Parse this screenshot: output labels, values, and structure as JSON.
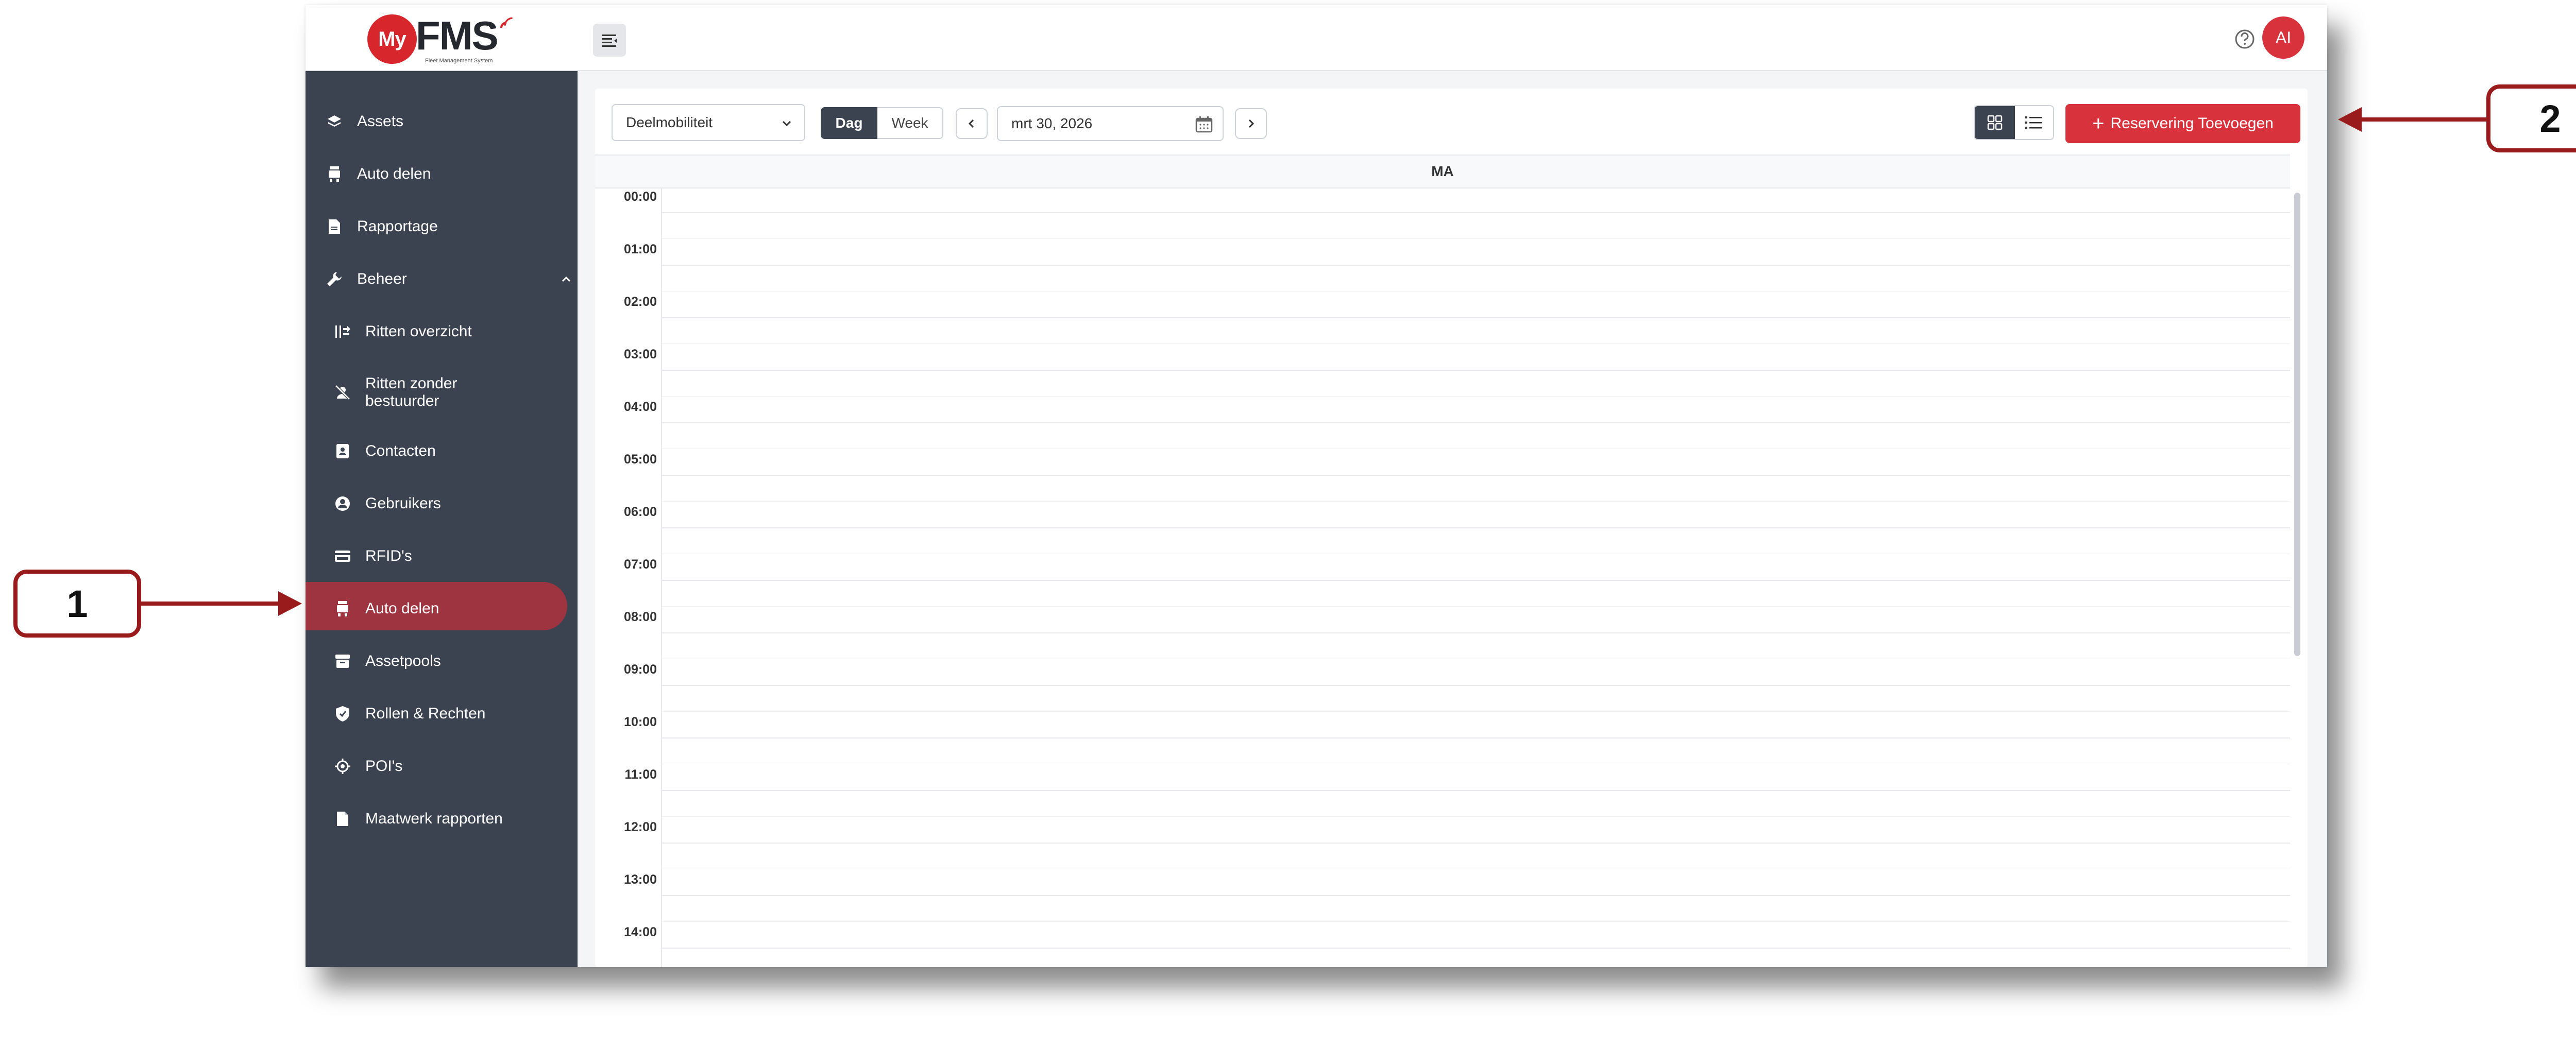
{
  "logo": {
    "circle_text": "My",
    "word": "FMS",
    "subtitle": "Fleet Management System"
  },
  "sidebar": {
    "items": [
      {
        "label": "Assets",
        "icon": "layers-icon"
      },
      {
        "label": "Auto delen",
        "icon": "car-share-icon"
      },
      {
        "label": "Rapportage",
        "icon": "report-icon"
      },
      {
        "label": "Beheer",
        "icon": "wrench-icon",
        "expanded": true
      },
      {
        "label": "Ritten overzicht",
        "icon": "trips-icon"
      },
      {
        "label": "Ritten zonder bestuurder",
        "line1": "Ritten zonder",
        "line2": "bestuurder",
        "icon": "no-driver-icon"
      },
      {
        "label": "Contacten",
        "icon": "contacts-icon"
      },
      {
        "label": "Gebruikers",
        "icon": "user-icon"
      },
      {
        "label": "RFID's",
        "icon": "card-icon"
      },
      {
        "label": "Auto delen",
        "icon": "car-share-icon",
        "active": true
      },
      {
        "label": "Assetpools",
        "icon": "archive-icon"
      },
      {
        "label": "Rollen & Rechten",
        "icon": "shield-icon"
      },
      {
        "label": "POI's",
        "icon": "target-icon"
      },
      {
        "label": "Maatwerk rapporten",
        "icon": "document-icon"
      }
    ],
    "active_color": "#9d3440",
    "background": "#3b4250"
  },
  "topbar": {
    "avatar_initials": "AI",
    "help_icon": "help-icon",
    "menu_icon": "menu-collapse-icon"
  },
  "toolbar": {
    "select_value": "Deelmobiliteit",
    "view_day": "Dag",
    "view_week": "Week",
    "date_value": "mrt 30, 2026",
    "add_button": "Reservering Toevoegen",
    "accent": "#d8333d"
  },
  "calendar": {
    "day_header": "MA",
    "hours": [
      "00:00",
      "01:00",
      "02:00",
      "03:00",
      "04:00",
      "05:00",
      "06:00",
      "07:00",
      "08:00",
      "09:00",
      "10:00",
      "11:00",
      "12:00",
      "13:00",
      "14:00"
    ]
  },
  "callouts": {
    "one": "1",
    "two": "2",
    "color": "#9a1b1b"
  }
}
